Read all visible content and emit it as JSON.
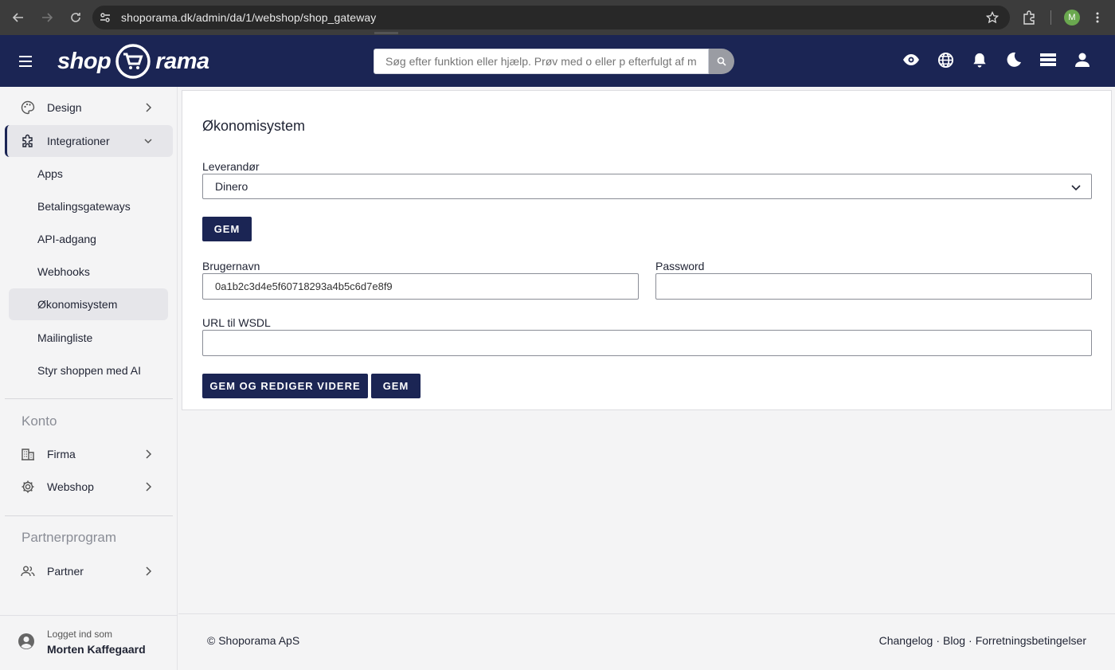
{
  "browser": {
    "url": "shoporama.dk/admin/da/1/webshop/shop_gateway",
    "profile_initial": "M"
  },
  "header": {
    "logo_left": "shop",
    "logo_right": "rama",
    "search_placeholder": "Søg efter funktion eller hjælp. Prøv med o eller p efterfulgt af mellemrum",
    "icons": [
      "eye-icon",
      "globe-icon",
      "bell-icon",
      "moon-icon",
      "layers-icon",
      "user-icon"
    ]
  },
  "sidebar": {
    "design": "Design",
    "integrationer": "Integrationer",
    "sub_items": [
      "Apps",
      "Betalingsgateways",
      "API-adgang",
      "Webhooks",
      "Økonomisystem",
      "Mailingliste",
      "Styr shoppen med AI"
    ],
    "konto_title": "Konto",
    "firma": "Firma",
    "webshop": "Webshop",
    "partner_title": "Partnerprogram",
    "partner": "Partner",
    "logged_in_label": "Logget ind som",
    "user_name": "Morten Kaffegaard"
  },
  "main": {
    "title": "Økonomisystem",
    "leverandor_label": "Leverandør",
    "leverandor_value": "Dinero",
    "save_label": "GEM",
    "brugernavn_label": "Brugernavn",
    "brugernavn_value": "0a1b2c3d4e5f60718293a4b5c6d7e8f9",
    "password_label": "Password",
    "password_value": "",
    "wsdl_label": "URL til WSDL",
    "wsdl_value": "",
    "save_continue_label": "GEM OG REDIGER VIDERE",
    "save2_label": "GEM"
  },
  "footer": {
    "copyright": "© Shoporama ApS",
    "changelog": "Changelog",
    "blog": "Blog",
    "terms": "Forretningsbetingelser",
    "sep": "·"
  },
  "colors": {
    "header_bg": "#1b2554",
    "button_bg": "#1b2554",
    "page_bg": "#f4f4f5"
  }
}
